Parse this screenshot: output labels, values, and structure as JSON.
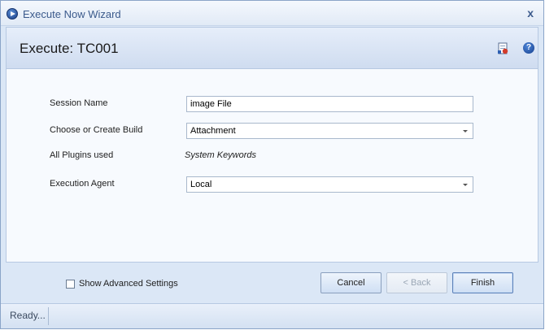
{
  "window": {
    "title": "Execute Now Wizard",
    "close_glyph": "x"
  },
  "header": {
    "title": "Execute: TC001",
    "icons": [
      "report-icon",
      "help-icon"
    ],
    "help_glyph": "?"
  },
  "form": {
    "session_name": {
      "label": "Session Name",
      "value": "image File"
    },
    "build": {
      "label": "Choose or Create Build",
      "value": "Attachment"
    },
    "plugins": {
      "label": "All Plugins used",
      "value": "System Keywords"
    },
    "agent": {
      "label": "Execution Agent",
      "value": "Local"
    }
  },
  "footer": {
    "advanced_settings_label": "Show Advanced Settings",
    "advanced_settings_checked": false,
    "cancel_label": "Cancel",
    "back_label": "< Back",
    "finish_label": "Finish"
  },
  "status": {
    "text": "Ready..."
  },
  "colors": {
    "accent": "#3b5a8c",
    "panel": "#dbe7f6",
    "content": "#f7fafe"
  }
}
